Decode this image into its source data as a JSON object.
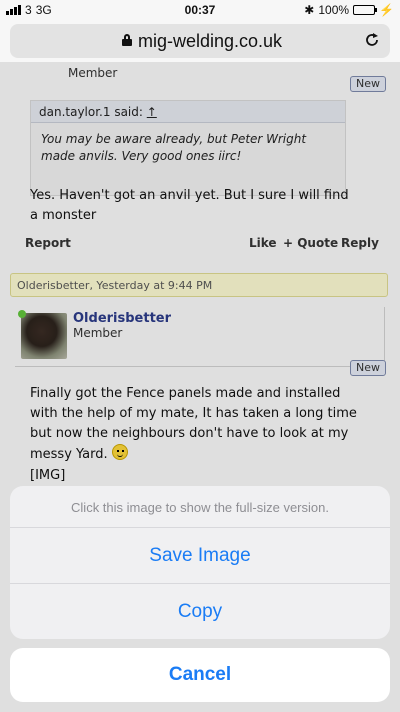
{
  "status": {
    "carrier": "3",
    "network": "3G",
    "time": "00:37",
    "battery": "100%"
  },
  "browser": {
    "url": "mig-welding.co.uk"
  },
  "post1": {
    "role": "Member",
    "new_badge": "New",
    "quote_author": "dan.taylor.1 said:",
    "quote_arrow": "↑",
    "quote_text": "You may be aware already, but Peter Wright made anvils. Very good ones iirc!",
    "text": "Yes. Haven't got an anvil yet. But I sure I will find a monster",
    "actions": {
      "report": "Report",
      "like": "Like",
      "quote": "+ Quote",
      "reply": "Reply"
    }
  },
  "post2": {
    "datebar": "Olderisbetter, Yesterday at 9:44 PM",
    "username": "Olderisbetter",
    "role": "Member",
    "new_badge": "New",
    "text": "Finally got the Fence panels made and installed with the help of my mate, It has taken a long time but now the neighbours don't have to look at my messy Yard.",
    "img_tag": "[IMG]"
  },
  "action_sheet": {
    "message": "Click this image to show the full-size version.",
    "save": "Save Image",
    "copy": "Copy",
    "cancel": "Cancel"
  },
  "colors": {
    "accent": "#1a7cf5",
    "username": "#2b3a86",
    "datebar_bg": "#f6f4cc"
  }
}
